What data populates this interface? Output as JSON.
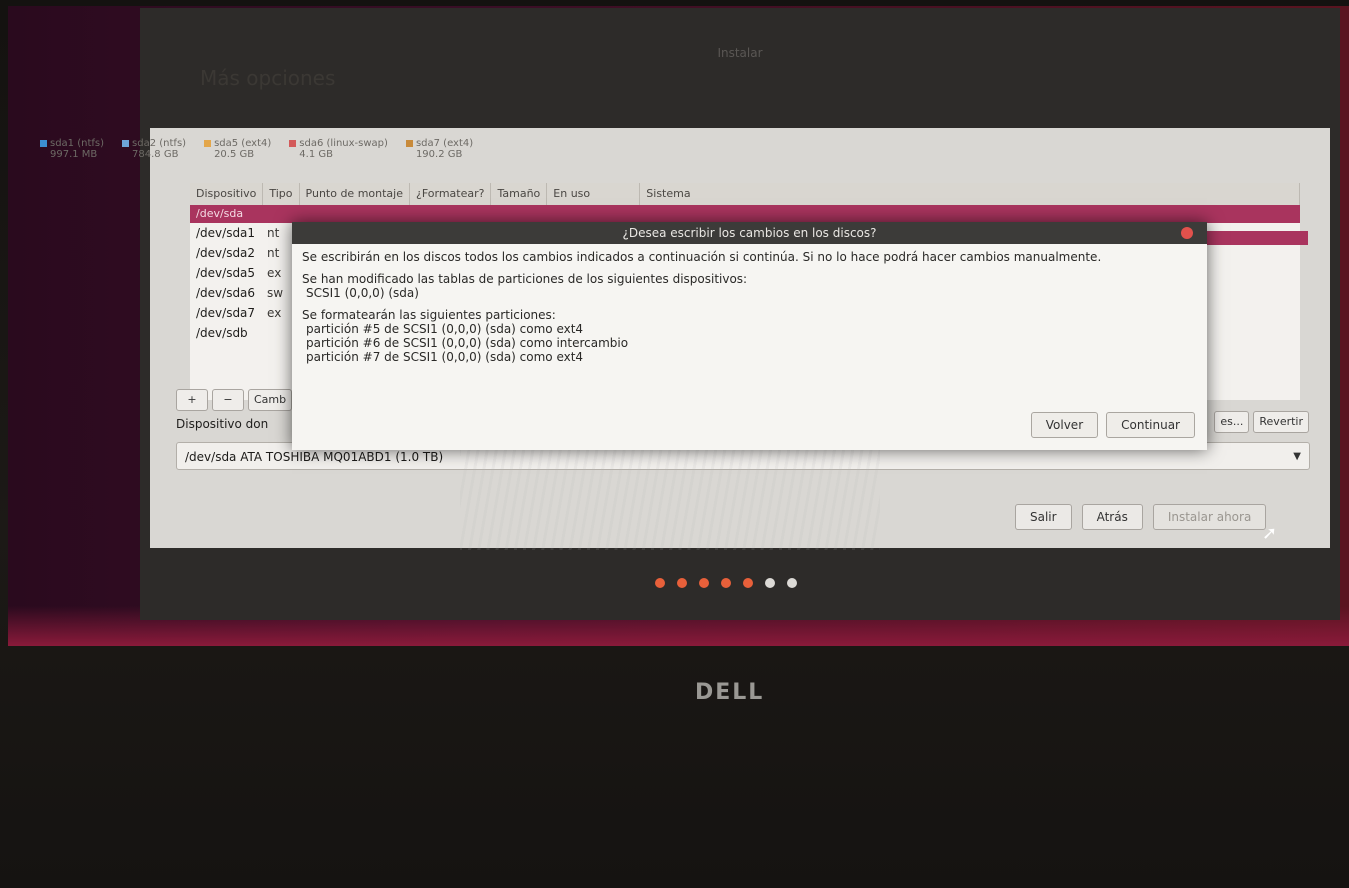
{
  "window": {
    "title": "Instalar",
    "heading": "Más opciones"
  },
  "legend": [
    {
      "name": "sda1 (ntfs)",
      "size": "997.1 MB",
      "color": "#3c8ed1"
    },
    {
      "name": "sda2 (ntfs)",
      "size": "784.8 GB",
      "color": "#6da5d8"
    },
    {
      "name": "sda5 (ext4)",
      "size": "20.5 GB",
      "color": "#e3a64a"
    },
    {
      "name": "sda6 (linux-swap)",
      "size": "4.1 GB",
      "color": "#d35a5a"
    },
    {
      "name": "sda7 (ext4)",
      "size": "190.2 GB",
      "color": "#c88a3a"
    }
  ],
  "table": {
    "columns": [
      "Dispositivo",
      "Tipo",
      "Punto de montaje",
      "¿Formatear?",
      "Tamaño",
      "En uso",
      "Sistema"
    ],
    "selected_row": "/dev/sda",
    "rows": [
      {
        "device": "/dev/sda1",
        "type": "nt"
      },
      {
        "device": "/dev/sda2",
        "type": "nt"
      },
      {
        "device": "/dev/sda5",
        "type": "ex"
      },
      {
        "device": "/dev/sda6",
        "type": "sw"
      },
      {
        "device": "/dev/sda7",
        "type": "ex"
      },
      {
        "device": "/dev/sdb",
        "type": ""
      }
    ]
  },
  "toolbar": {
    "add": "+",
    "remove": "−",
    "change": "Camb",
    "new_table": "es...",
    "revert": "Revertir"
  },
  "bootloader": {
    "label": "Dispositivo don",
    "selected": "/dev/sda   ATA TOSHIBA MQ01ABD1 (1.0 TB)"
  },
  "nav": {
    "quit": "Salir",
    "back": "Atrás",
    "install": "Instalar ahora"
  },
  "progress": {
    "total": 7,
    "completed": 5,
    "done_color": "#e8603a",
    "todo_color": "#dcdad6"
  },
  "dialog": {
    "title": "¿Desea escribir los cambios en los discos?",
    "line1": "Se escribirán en los discos todos los cambios indicados a continuación si continúa. Si no lo hace podrá hacer cambios manualmente.",
    "line2": "Se han modificado las tablas de particiones de los siguientes dispositivos:",
    "line3": "SCSI1 (0,0,0) (sda)",
    "line4": "Se formatearán las siguientes particiones:",
    "line5": "partición #5 de SCSI1 (0,0,0) (sda) como ext4",
    "line6": "partición #6 de SCSI1 (0,0,0) (sda) como intercambio",
    "line7": "partición #7 de SCSI1 (0,0,0) (sda) como ext4",
    "back_button": "Volver",
    "continue_button": "Continuar"
  },
  "brand": "DELL"
}
